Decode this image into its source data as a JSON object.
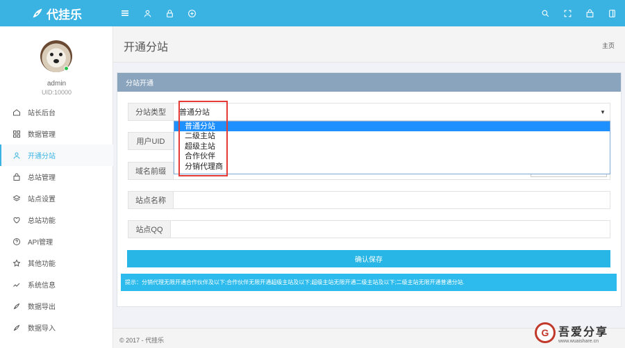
{
  "brand": {
    "name": "代挂乐"
  },
  "topbar": {
    "left_icons": [
      "menu-icon",
      "user-icon",
      "lock-icon",
      "plus-circle-icon"
    ],
    "right_icons": [
      "search-icon",
      "fullscreen-icon",
      "bag-icon",
      "panel-icon"
    ]
  },
  "user": {
    "name": "admin",
    "uid": "UID:10000"
  },
  "sidebar": {
    "items": [
      {
        "label": "站长后台",
        "icon": "home-icon"
      },
      {
        "label": "数据管理",
        "icon": "grid-icon"
      },
      {
        "label": "开通分站",
        "icon": "user-icon",
        "active": true
      },
      {
        "label": "总站管理",
        "icon": "bag-icon"
      },
      {
        "label": "站点设置",
        "icon": "layers-icon"
      },
      {
        "label": "总站功能",
        "icon": "heart-icon"
      },
      {
        "label": "API管理",
        "icon": "question-icon"
      },
      {
        "label": "其他功能",
        "icon": "star-icon"
      },
      {
        "label": "系统信息",
        "icon": "chart-icon"
      },
      {
        "label": "数据导出",
        "icon": "rocket-icon"
      },
      {
        "label": "数据导入",
        "icon": "rocket-icon"
      }
    ]
  },
  "page": {
    "title": "开通分站",
    "breadcrumb": "主页"
  },
  "panel": {
    "title": "分站开通",
    "rows": {
      "type_label": "分站类型",
      "type_value": "普通分站",
      "uid_label": "用户UID",
      "domain_label": "域名前缀",
      "site_name_label": "站点名称",
      "site_qq_label": "站点QQ"
    },
    "dropdown_options": [
      "普通分站",
      "二级主站",
      "超级主站",
      "合作伙伴",
      "分销代理商"
    ],
    "save_label": "确认保存",
    "tip": "提示：分销代理无限开通合作伙伴及以下;合作伙伴无限开通超级主站及以下;超级主站无限开通二级主站及以下;二级主站无限开通普通分站."
  },
  "footer": {
    "copyright": "© 2017 - 代挂乐"
  },
  "watermark": {
    "title": "吾爱分享",
    "url": "www.wuaishare.cn"
  },
  "colors": {
    "topbar": "#3ab3e3",
    "panel_head": "#8ba4be",
    "save": "#27b6e6",
    "tip": "#2cbbec",
    "highlight": "#1e90ff",
    "annotation": "#e53935"
  }
}
